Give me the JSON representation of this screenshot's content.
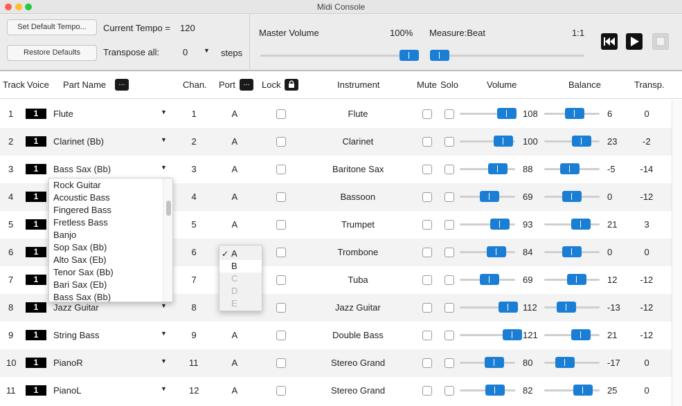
{
  "window": {
    "title": "Midi Console"
  },
  "toolbar": {
    "set_default_tempo": "Set Default Tempo...",
    "restore_defaults": "Restore Defaults",
    "current_tempo_label": "Current Tempo =",
    "current_tempo_value": "120",
    "transpose_label": "Transpose all:",
    "transpose_value": "0",
    "steps_label": "steps",
    "master_volume_label": "Master Volume",
    "master_volume_value": "100%",
    "master_volume_level": 1.0,
    "measure_label": "Measure:Beat",
    "measure_value": "1:1",
    "measure_position": 0.0
  },
  "columns": {
    "track": "Track",
    "voice": "Voice",
    "part_name": "Part Name",
    "chan": "Chan.",
    "port": "Port",
    "lock": "Lock",
    "instrument": "Instrument",
    "mute": "Mute",
    "solo": "Solo",
    "volume": "Volume",
    "balance": "Balance",
    "transp": "Transp.",
    "more_glyph": "..."
  },
  "tracks": [
    {
      "track": "1",
      "voice": "1",
      "part": "Flute",
      "chan": "1",
      "port": "A",
      "instrument": "Flute",
      "volume": "108",
      "volume_level": 0.85,
      "balance": "6",
      "balance_level": 0.55,
      "transp": "0"
    },
    {
      "track": "2",
      "voice": "1",
      "part": "Clarinet (Bb)",
      "chan": "2",
      "port": "A",
      "instrument": "Clarinet",
      "volume": "100",
      "volume_level": 0.79,
      "balance": "23",
      "balance_level": 0.68,
      "transp": "-2"
    },
    {
      "track": "3",
      "voice": "1",
      "part": "Bass Sax (Bb)",
      "chan": "3",
      "port": "A",
      "instrument": "Baritone Sax",
      "volume": "88",
      "volume_level": 0.69,
      "balance": "-5",
      "balance_level": 0.46,
      "transp": "-14"
    },
    {
      "track": "4",
      "voice": "1",
      "part": "",
      "chan": "4",
      "port": "A",
      "instrument": "Bassoon",
      "volume": "69",
      "volume_level": 0.54,
      "balance": "0",
      "balance_level": 0.5,
      "transp": "-12"
    },
    {
      "track": "5",
      "voice": "1",
      "part": "",
      "chan": "5",
      "port": "A",
      "instrument": "Trumpet",
      "volume": "93",
      "volume_level": 0.73,
      "balance": "21",
      "balance_level": 0.66,
      "transp": "3"
    },
    {
      "track": "6",
      "voice": "1",
      "part": "",
      "chan": "6",
      "port": "",
      "instrument": "Trombone",
      "volume": "84",
      "volume_level": 0.66,
      "balance": "0",
      "balance_level": 0.5,
      "transp": "0"
    },
    {
      "track": "7",
      "voice": "1",
      "part": "",
      "chan": "7",
      "port": "",
      "instrument": "Tuba",
      "volume": "69",
      "volume_level": 0.54,
      "balance": "12",
      "balance_level": 0.59,
      "transp": "-12"
    },
    {
      "track": "8",
      "voice": "1",
      "part": "Jazz Guitar",
      "chan": "8",
      "port": "",
      "instrument": "Jazz Guitar",
      "volume": "112",
      "volume_level": 0.88,
      "balance": "-13",
      "balance_level": 0.4,
      "transp": "-12"
    },
    {
      "track": "9",
      "voice": "1",
      "part": "String Bass",
      "chan": "9",
      "port": "A",
      "instrument": "Double Bass",
      "volume": "121",
      "volume_level": 0.95,
      "balance": "21",
      "balance_level": 0.66,
      "transp": "-12"
    },
    {
      "track": "10",
      "voice": "1",
      "part": "PianoR",
      "chan": "11",
      "port": "A",
      "instrument": "Stereo Grand",
      "volume": "80",
      "volume_level": 0.63,
      "balance": "-17",
      "balance_level": 0.37,
      "transp": "0"
    },
    {
      "track": "11",
      "voice": "1",
      "part": "PianoL",
      "chan": "12",
      "port": "A",
      "instrument": "Stereo Grand",
      "volume": "82",
      "volume_level": 0.64,
      "balance": "25",
      "balance_level": 0.7,
      "transp": "0"
    }
  ],
  "part_dropdown": {
    "items": [
      "Rock Guitar",
      "Acoustic Bass",
      "Fingered Bass",
      "Fretless Bass",
      "Banjo",
      "Sop Sax (Bb)",
      "Alto Sax (Eb)",
      "Tenor Sax (Bb)",
      "Bari Sax (Eb)",
      "Bass Sax (Bb)"
    ],
    "selected": "Bass Sax (Bb)"
  },
  "port_menu": {
    "checkmark": "✓",
    "items": [
      "A",
      "B",
      "C",
      "D",
      "E"
    ],
    "checked": "A",
    "highlighted": "B",
    "disabled": [
      "C",
      "D",
      "E"
    ]
  },
  "colors": {
    "slider_knob": "#1a7fd4",
    "voice_box": "#000000",
    "row_alt": "#f3f3f3"
  }
}
